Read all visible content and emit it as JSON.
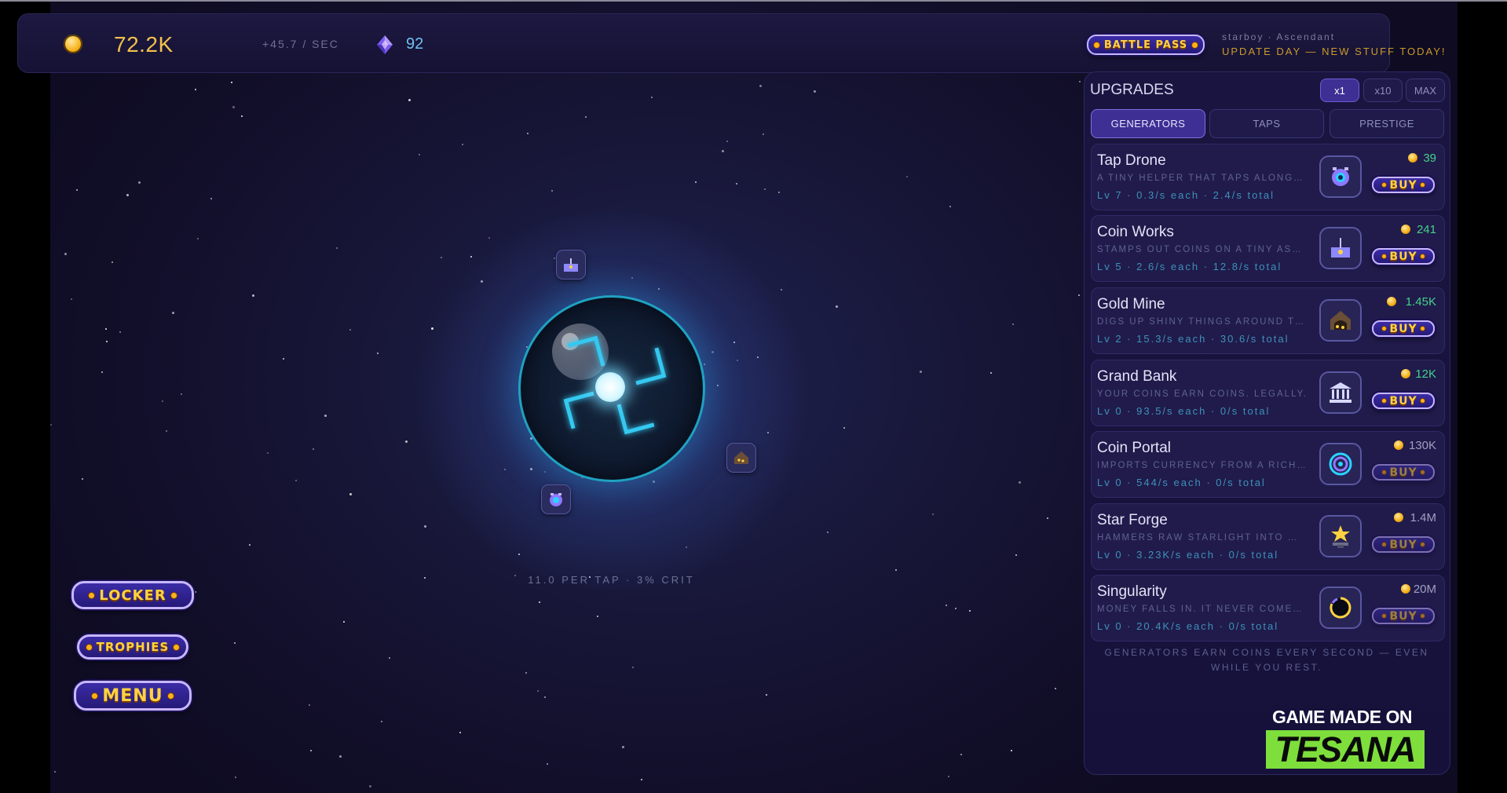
{
  "hud": {
    "coins": "72.2K",
    "rate": "+45.7 / SEC",
    "gems": "92",
    "battle_pass_label": "BATTLE PASS",
    "user_line": "starboy · Ascendant",
    "news": "UPDATE DAY — NEW STUFF TODAY!"
  },
  "orb": {
    "tap_stats": "11.0 PER TAP  ·  3% CRIT"
  },
  "left_menu": {
    "locker": "LOCKER",
    "trophies": "TROPHIES",
    "menu": "MENU"
  },
  "upgrades": {
    "title": "UPGRADES",
    "multipliers": [
      "x1",
      "x10",
      "MAX"
    ],
    "active_multiplier": "x1",
    "tabs": [
      "GENERATORS",
      "TAPS",
      "PRESTIGE"
    ],
    "active_tab": "GENERATORS",
    "items": [
      {
        "name": "Tap Drone",
        "desc": "A TINY HELPER THAT TAPS ALONG…",
        "stats": "Lv 7 · 0.3/s each · 2.4/s total",
        "cost": "39",
        "icon": "drone-icon",
        "affordable": true,
        "buy": "BUY"
      },
      {
        "name": "Coin Works",
        "desc": "STAMPS OUT COINS ON A TINY AS…",
        "stats": "Lv 5 · 2.6/s each · 12.8/s total",
        "cost": "241",
        "icon": "factory-icon",
        "affordable": true,
        "buy": "BUY"
      },
      {
        "name": "Gold Mine",
        "desc": "DIGS UP SHINY THINGS AROUND T…",
        "stats": "Lv 2 · 15.3/s each · 30.6/s total",
        "cost": "1.45K",
        "icon": "mine-icon",
        "affordable": true,
        "buy": "BUY"
      },
      {
        "name": "Grand Bank",
        "desc": "YOUR COINS EARN COINS. LEGALLY.",
        "stats": "Lv 0 · 93.5/s each · 0/s total",
        "cost": "12K",
        "icon": "bank-icon",
        "affordable": true,
        "buy": "BUY"
      },
      {
        "name": "Coin Portal",
        "desc": "IMPORTS CURRENCY FROM A RICH…",
        "stats": "Lv 0 · 544/s each · 0/s total",
        "cost": "130K",
        "icon": "portal-icon",
        "affordable": false,
        "buy": "BUY"
      },
      {
        "name": "Star Forge",
        "desc": "HAMMERS RAW STARLIGHT INTO …",
        "stats": "Lv 0 · 3.23K/s each · 0/s total",
        "cost": "1.4M",
        "icon": "star-anvil-icon",
        "affordable": false,
        "buy": "BUY"
      },
      {
        "name": "Singularity",
        "desc": "MONEY FALLS IN. IT NEVER COME…",
        "stats": "Lv 0 · 20.4K/s each · 0/s total",
        "cost": "20M",
        "icon": "black-hole-icon",
        "affordable": false,
        "buy": "BUY"
      }
    ],
    "footer": "GENERATORS EARN COINS EVERY SECOND — EVEN WHILE YOU REST."
  },
  "brand": {
    "made": "GAME MADE ON",
    "name": "TESANA"
  },
  "colors": {
    "coin_gold": "#f2c14b",
    "gem_blue": "#6fc1f2",
    "affordable_green": "#45d08a",
    "accent_purple": "#3d2f93",
    "orb_cyan": "#35c8f0",
    "brand_green": "#7dde3c"
  }
}
